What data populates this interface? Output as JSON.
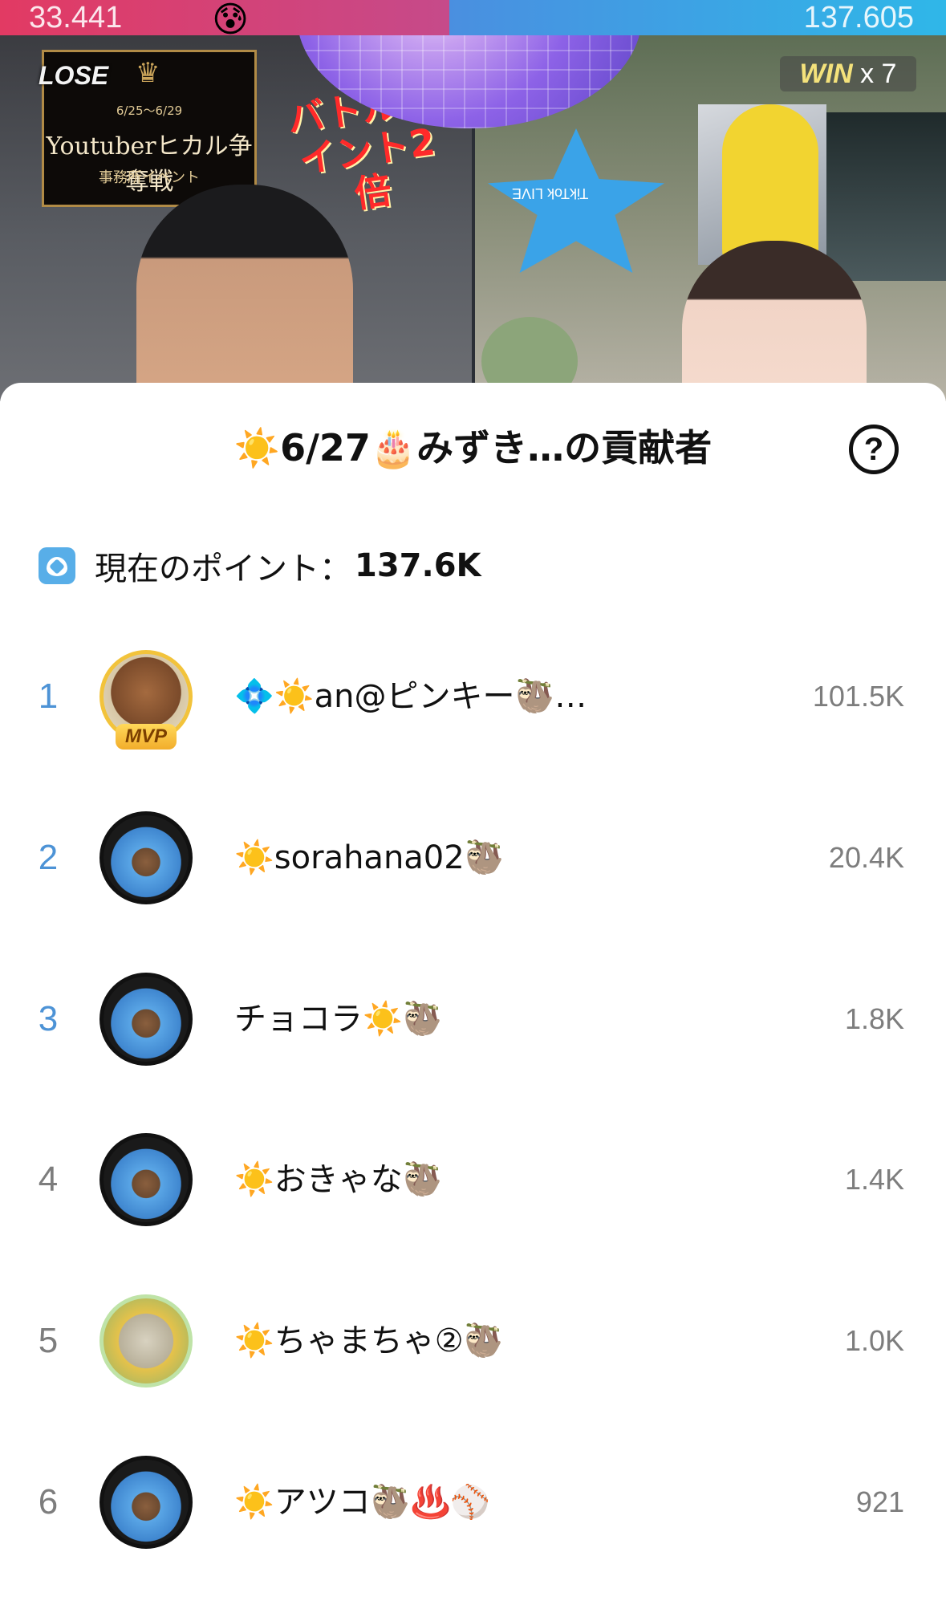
{
  "battle": {
    "left_score": "33.441",
    "right_score": "137.605",
    "sad_emoji": "😰",
    "lose_label": "LOSE",
    "event_dates": "6/25～6/29",
    "event_title": "Youtuberヒカル争奪戦",
    "event_subtitle": "事務所イベント",
    "promo_sign": "バトルポイント2倍",
    "win_word": "WIN",
    "win_count": "x 7",
    "tiktok_label": "TikTok LIVE"
  },
  "sheet": {
    "title": "☀️6/27🎂みずき…の貢献者",
    "help_label": "?",
    "points_label": "現在のポイント：",
    "points_value": "137.6K"
  },
  "contributors": [
    {
      "rank": "1",
      "name": "💠☀️an@ピンキー🦥…",
      "score": "101.5K",
      "mvp": "MVP"
    },
    {
      "rank": "2",
      "name": "☀️sorahana02🦥",
      "score": "20.4K"
    },
    {
      "rank": "3",
      "name": "チョコラ☀️🦥",
      "score": "1.8K"
    },
    {
      "rank": "4",
      "name": "☀️おきゃな🦥",
      "score": "1.4K"
    },
    {
      "rank": "5",
      "name": "☀️ちゃまちゃ②🦥",
      "score": "1.0K"
    },
    {
      "rank": "6",
      "name": "☀️アツコ🦥♨️⚾",
      "score": "921"
    }
  ],
  "colors": {
    "rank_top": "#4d93d6",
    "rank_rest": "#7d7d7d",
    "score_text": "#7d7d7d",
    "mvp_gold": "#f2c33b",
    "left_bar": "#e23a63",
    "right_bar": "#2fb7e8"
  }
}
